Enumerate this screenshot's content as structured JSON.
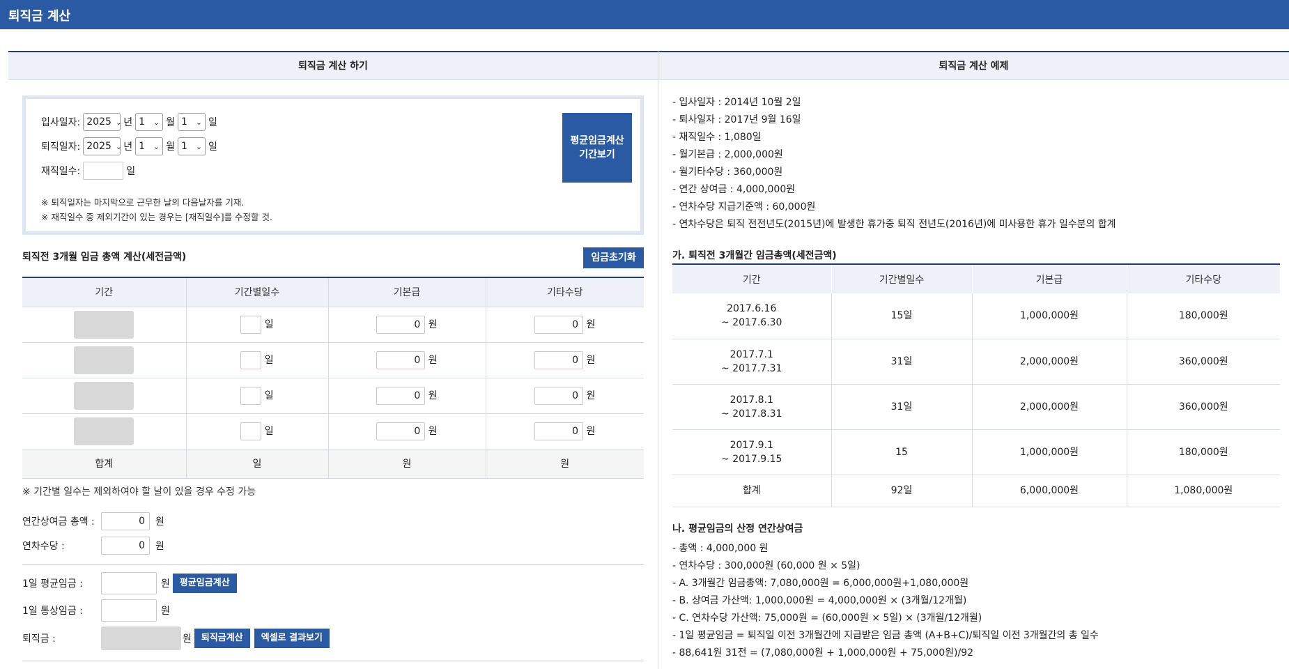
{
  "app": {
    "title": "퇴직금 계산"
  },
  "left": {
    "header": "퇴직금 계산 하기",
    "dates": {
      "join_label": "입사일자:",
      "leave_label": "퇴직일자:",
      "days_label": "재직일수:",
      "join": {
        "year": "2025",
        "month": "1",
        "day": "1"
      },
      "leave": {
        "year": "2025",
        "month": "1",
        "day": "1"
      },
      "unit_year": "년",
      "unit_month": "월",
      "unit_day": "일",
      "days_unit": "일",
      "days_value": "",
      "note1": "※ 퇴직일자는 마지막으로 근무한 날의 다음날자를 기재.",
      "note2": "※ 재직일수 중 제외기간이 있는 경우는 [재직일수]를 수정할 것.",
      "period_button": "평균임금계산\n기간보기"
    },
    "wage_section_title": "퇴직전 3개월 임금 총액 계산(세전금액)",
    "reset_button": "임금초기화",
    "table": {
      "headers": [
        "기간",
        "기간별일수",
        "기본급",
        "기타수당"
      ],
      "rows": [
        {
          "days_unit": "일",
          "base": "0",
          "base_unit": "원",
          "other": "0",
          "other_unit": "원"
        },
        {
          "days_unit": "일",
          "base": "0",
          "base_unit": "원",
          "other": "0",
          "other_unit": "원"
        },
        {
          "days_unit": "일",
          "base": "0",
          "base_unit": "원",
          "other": "0",
          "other_unit": "원"
        },
        {
          "days_unit": "일",
          "base": "0",
          "base_unit": "원",
          "other": "0",
          "other_unit": "원"
        }
      ],
      "sum": {
        "label": "합계",
        "days": "일",
        "base": "원",
        "other": "원"
      }
    },
    "table_note": "※ 기간별 일수는 제외하여야 할 날이 있을 경우 수정 가능",
    "bonus": {
      "label": "연간상여금 총액 :",
      "value": "0",
      "unit": "원"
    },
    "leave_pay": {
      "label": "연차수당 :",
      "value": "0",
      "unit": "원"
    },
    "avg_wage": {
      "label": "1일 평균임금 :",
      "unit": "원",
      "button": "평균임금계산"
    },
    "ord_wage": {
      "label": "1일 통상임금 :",
      "unit": "원"
    },
    "severance": {
      "label": "퇴직금 :",
      "unit": "원",
      "calc_button": "퇴직금계산",
      "excel_button": "엑셀로 결과보기"
    }
  },
  "right": {
    "header": "퇴직금 계산 예제",
    "info": [
      "- 입사일자 : 2014년 10월 2일",
      "- 퇴사일자 : 2017년 9월 16일",
      "- 재직일수 : 1,080일",
      "- 월기본급 : 2,000,000원",
      "- 월기타수당 : 360,000원",
      "- 연간 상여금 : 4,000,000원",
      "- 연차수당 지급기준액 : 60,000원",
      "- 연차수당은 퇴직 전전년도(2015년)에 발생한 휴가중 퇴직 전년도(2016년)에 미사용한 휴가 일수분의 합계"
    ],
    "section_a_title": "가. 퇴직전 3개월간 임금총액(세전금액)",
    "table": {
      "headers": [
        "기간",
        "기간별일수",
        "기본급",
        "기타수당"
      ],
      "rows": [
        {
          "period1": "2017.6.16",
          "period2": "~ 2017.6.30",
          "days": "15일",
          "base": "1,000,000원",
          "other": "180,000원"
        },
        {
          "period1": "2017.7.1",
          "period2": "~ 2017.7.31",
          "days": "31일",
          "base": "2,000,000원",
          "other": "360,000원"
        },
        {
          "period1": "2017.8.1",
          "period2": "~ 2017.8.31",
          "days": "31일",
          "base": "2,000,000원",
          "other": "360,000원"
        },
        {
          "period1": "2017.9.1",
          "period2": "~ 2017.9.15",
          "days": "15",
          "base": "1,000,000원",
          "other": "180,000원"
        }
      ],
      "sum": {
        "label": "합계",
        "days": "92일",
        "base": "6,000,000원",
        "other": "1,080,000원"
      }
    },
    "section_b_title": "나. 평균임금의 산정 연간상여금",
    "calc": [
      "- 총액 : 4,000,000 원",
      "- 연차수당 : 300,000원 (60,000 원 × 5일)",
      "- A. 3개월간 임금총액: 7,080,000원 = 6,000,000원+1,080,000원",
      "- B. 상여금 가산액: 1,000,000원 = 4,000,000원 × (3개월/12개월)",
      "- C. 연차수당 가산액: 75,000원 = (60,000원 × 5일) × (3개월/12개월)",
      "- 1일 평균임금 = 퇴직일 이전 3개월간에 지급받은 임금 총액 (A+B+C)/퇴직일 이전 3개월간의 총 일수",
      "- 88,641원 31전 = (7,080,000원 + 1,000,000원 + 75,000원)/92"
    ]
  }
}
